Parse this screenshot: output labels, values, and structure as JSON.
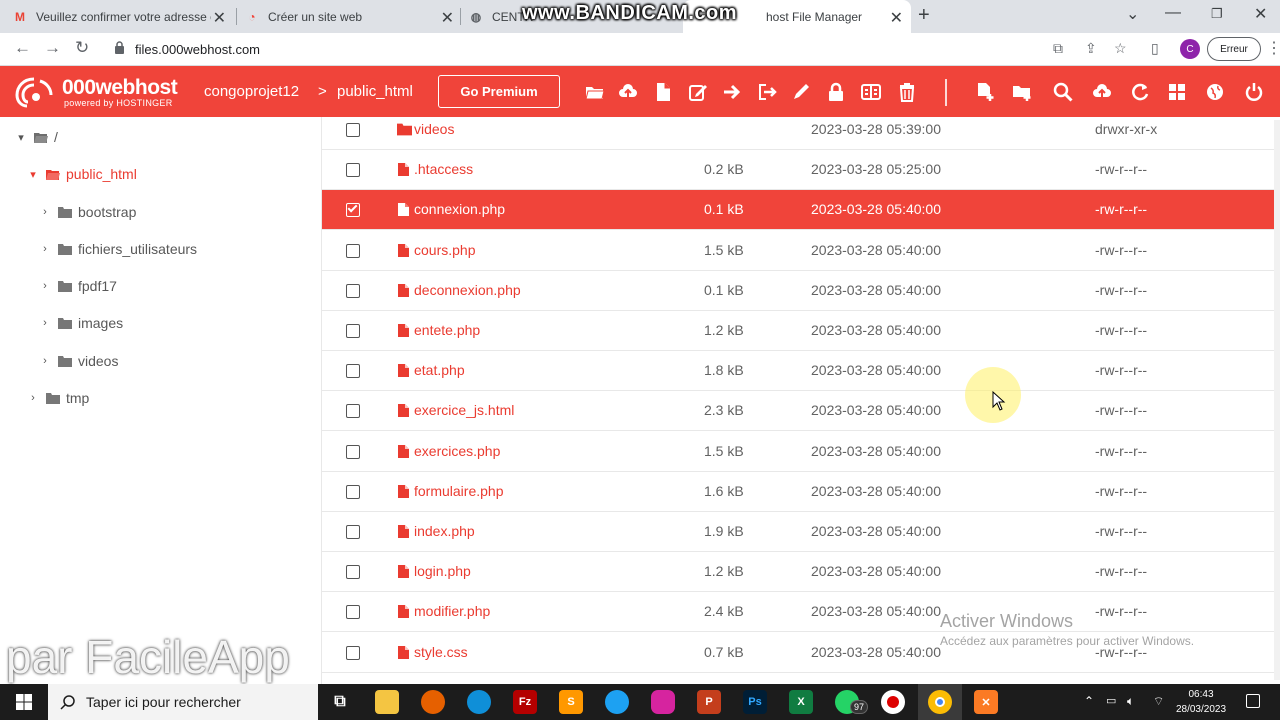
{
  "browser": {
    "tabs": [
      {
        "label": "Veuillez confirmer votre adresse e",
        "favicon": "gmail-icon",
        "close": "✕"
      },
      {
        "label": "Créer un site web",
        "favicon": "hostinger-icon",
        "close": "✕"
      },
      {
        "label": "CENTR",
        "favicon": "globe-icon",
        "close": "✕"
      },
      {
        "label": "host File Manager",
        "favicon": "000webhost-icon",
        "close": "✕"
      }
    ],
    "new_tab_label": "+",
    "watermark": "www.BANDICAM.com",
    "url": "files.000webhost.com",
    "profile_initial": "C",
    "error_label": "Erreur",
    "menu_label": "⋮"
  },
  "app": {
    "brand": "000webhost",
    "brand_sub": "powered by HOSTINGER",
    "breadcrumb": [
      "congoprojet12",
      "public_html"
    ],
    "breadcrumb_sep": ">",
    "premium_label": "Go Premium",
    "accent": "#f0443a"
  },
  "tree": [
    {
      "label": "/",
      "caret": "▾",
      "indent": 0,
      "red": false,
      "open": true
    },
    {
      "label": "public_html",
      "caret": "▾",
      "indent": 1,
      "red": true,
      "open": true
    },
    {
      "label": "bootstrap",
      "caret": "›",
      "indent": 2,
      "red": false,
      "open": false
    },
    {
      "label": "fichiers_utilisateurs",
      "caret": "›",
      "indent": 2,
      "red": false,
      "open": false
    },
    {
      "label": "fpdf17",
      "caret": "›",
      "indent": 2,
      "red": false,
      "open": false
    },
    {
      "label": "images",
      "caret": "›",
      "indent": 2,
      "red": false,
      "open": false
    },
    {
      "label": "videos",
      "caret": "›",
      "indent": 2,
      "red": false,
      "open": false
    },
    {
      "label": "tmp",
      "caret": "›",
      "indent": 1,
      "red": false,
      "open": false
    }
  ],
  "files": [
    {
      "name": "videos",
      "type": "folder",
      "size": "",
      "date": "2023-03-28 05:39:00",
      "perms": "drwxr-xr-x",
      "selected": false
    },
    {
      "name": ".htaccess",
      "type": "file",
      "size": "0.2 kB",
      "date": "2023-03-28 05:25:00",
      "perms": "-rw-r--r--",
      "selected": false
    },
    {
      "name": "connexion.php",
      "type": "file",
      "size": "0.1 kB",
      "date": "2023-03-28 05:40:00",
      "perms": "-rw-r--r--",
      "selected": true
    },
    {
      "name": "cours.php",
      "type": "file",
      "size": "1.5 kB",
      "date": "2023-03-28 05:40:00",
      "perms": "-rw-r--r--",
      "selected": false
    },
    {
      "name": "deconnexion.php",
      "type": "file",
      "size": "0.1 kB",
      "date": "2023-03-28 05:40:00",
      "perms": "-rw-r--r--",
      "selected": false
    },
    {
      "name": "entete.php",
      "type": "file",
      "size": "1.2 kB",
      "date": "2023-03-28 05:40:00",
      "perms": "-rw-r--r--",
      "selected": false
    },
    {
      "name": "etat.php",
      "type": "file",
      "size": "1.8 kB",
      "date": "2023-03-28 05:40:00",
      "perms": "-rw-r--r--",
      "selected": false
    },
    {
      "name": "exercice_js.html",
      "type": "file",
      "size": "2.3 kB",
      "date": "2023-03-28 05:40:00",
      "perms": "-rw-r--r--",
      "selected": false
    },
    {
      "name": "exercices.php",
      "type": "file",
      "size": "1.5 kB",
      "date": "2023-03-28 05:40:00",
      "perms": "-rw-r--r--",
      "selected": false
    },
    {
      "name": "formulaire.php",
      "type": "file",
      "size": "1.6 kB",
      "date": "2023-03-28 05:40:00",
      "perms": "-rw-r--r--",
      "selected": false
    },
    {
      "name": "index.php",
      "type": "file",
      "size": "1.9 kB",
      "date": "2023-03-28 05:40:00",
      "perms": "-rw-r--r--",
      "selected": false
    },
    {
      "name": "login.php",
      "type": "file",
      "size": "1.2 kB",
      "date": "2023-03-28 05:40:00",
      "perms": "-rw-r--r--",
      "selected": false
    },
    {
      "name": "modifier.php",
      "type": "file",
      "size": "2.4 kB",
      "date": "2023-03-28 05:40:00",
      "perms": "-rw-r--r--",
      "selected": false
    },
    {
      "name": "style.css",
      "type": "file",
      "size": "0.7 kB",
      "date": "2023-03-28 05:40:00",
      "perms": "-rw-r--r--",
      "selected": false
    }
  ],
  "overlay": {
    "activate_title": "Activer Windows",
    "activate_sub": "Accédez aux paramètres pour activer Windows.",
    "facileapp": "par FacileApp"
  },
  "taskbar": {
    "search_placeholder": "Taper ici pour rechercher",
    "whatsapp_badge": "97",
    "time": "06:43",
    "date": "28/03/2023"
  }
}
